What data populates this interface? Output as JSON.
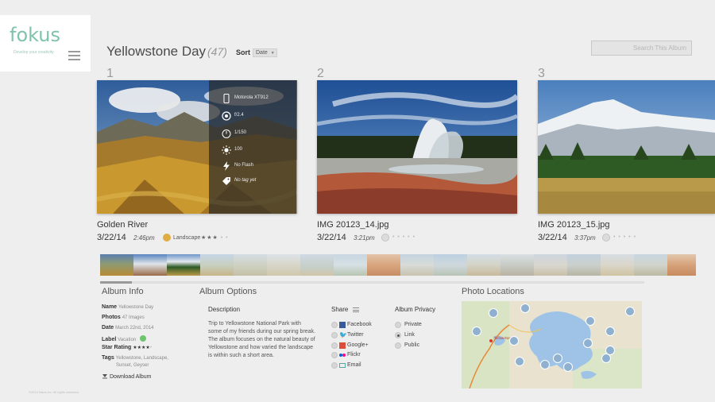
{
  "app": {
    "logo": "fokus",
    "tagline": "Develop your creativity"
  },
  "header": {
    "title": "Yellowstone Day",
    "count": "(47)",
    "sort_label": "Sort",
    "sort_value": "Date",
    "search_placeholder": "Search This Album"
  },
  "photos": [
    {
      "index": "1",
      "name": "Golden River",
      "date": "3/22/14",
      "time": "2:46pm",
      "label": "Landscape",
      "label_color": "#e0ad43",
      "stars": "★★★",
      "empty_stars": "• •"
    },
    {
      "index": "2",
      "name": "IMG 20123_14.jpg",
      "date": "3/22/14",
      "time": "3:21pm",
      "label": "",
      "label_color": "#dcdcdc",
      "stars": "",
      "empty_stars": "• • • • •"
    },
    {
      "index": "3",
      "name": "IMG 20123_15.jpg",
      "date": "3/22/14",
      "time": "3:37pm",
      "label": "",
      "label_color": "#dcdcdc",
      "stars": "",
      "empty_stars": "• • • • •"
    }
  ],
  "metadata": {
    "camera": "Motorola XT912",
    "aperture": "f/2.4",
    "shutter": "1/150",
    "iso": "100",
    "flash": "No Flash",
    "tags": "No tag yet"
  },
  "album_info": {
    "heading": "Album Info",
    "name_label": "Name",
    "name_value": "Yellowstone Day",
    "photos_label": "Photos",
    "photos_value": "47 Images",
    "date_label": "Date",
    "date_value": "March 22nd, 2014",
    "label_label": "Label",
    "label_value": "Vacation",
    "label_color": "#6cc46c",
    "rating_label": "Star Rating",
    "rating_value": "★★★★",
    "rating_empty": "•",
    "tags_label": "Tags",
    "tags_value_1": "Yellowstone, Landscape,",
    "tags_value_2": "Sunset, Geyser",
    "download": "Download Album"
  },
  "album_options": {
    "heading": "Album Options",
    "description_heading": "Description",
    "description": "Trip to Yellowstone National Park with some of my friends during our spring break. The album focuses on the natural beauty of Yellowstone and how varied the landscape is within such a short area.",
    "share_heading": "Share",
    "share_items": [
      "Facebook",
      "Twitter",
      "Google+",
      "Flickr",
      "Email"
    ],
    "privacy_heading": "Album Privacy",
    "privacy_items": [
      "Private",
      "Link",
      "Public"
    ],
    "privacy_selected": "Link"
  },
  "locations": {
    "heading": "Photo Locations"
  },
  "footer": "©2014 fokus inc. All rights reserved.",
  "colors": {
    "accent": "#7fc3ac",
    "background": "#eeeeef"
  }
}
